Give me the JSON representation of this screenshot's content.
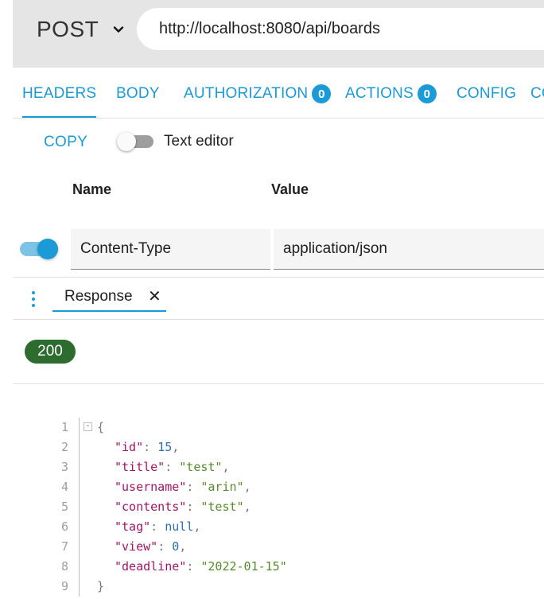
{
  "request": {
    "method": "POST",
    "url": "http://localhost:8080/api/boards"
  },
  "tabs": [
    {
      "label": "HEADERS",
      "active": true
    },
    {
      "label": "BODY"
    },
    {
      "label": "AUTHORIZATION",
      "badge": "0"
    },
    {
      "label": "ACTIONS",
      "badge": "0"
    },
    {
      "label": "CONFIG"
    },
    {
      "label": "CO"
    }
  ],
  "headers_panel": {
    "copy_label": "COPY",
    "text_editor_label": "Text editor",
    "text_editor_enabled": false,
    "name_column": "Name",
    "value_column": "Value",
    "rows": [
      {
        "enabled": true,
        "name": "Content-Type",
        "value": "application/json"
      }
    ]
  },
  "response": {
    "tab_label": "Response",
    "close_symbol": "✕",
    "status_code": "200",
    "status_color": "#2e6b2e"
  },
  "code": {
    "line_numbers": [
      "1",
      "2",
      "3",
      "4",
      "5",
      "6",
      "7",
      "8",
      "9"
    ],
    "fold_symbol": "-",
    "open_brace": "{",
    "close_brace": "}",
    "entries": [
      {
        "key": "\"id\"",
        "value": "15",
        "type": "number",
        "comma": ","
      },
      {
        "key": "\"title\"",
        "value": "\"test\"",
        "type": "string",
        "comma": ","
      },
      {
        "key": "\"username\"",
        "value": "\"arin\"",
        "type": "string",
        "comma": ","
      },
      {
        "key": "\"contents\"",
        "value": "\"test\"",
        "type": "string",
        "comma": ","
      },
      {
        "key": "\"tag\"",
        "value": "null",
        "type": "number",
        "comma": ","
      },
      {
        "key": "\"view\"",
        "value": "0",
        "type": "number",
        "comma": ","
      },
      {
        "key": "\"deadline\"",
        "value": "\"2022-01-15\"",
        "type": "string",
        "comma": ""
      }
    ]
  },
  "colors": {
    "accent": "#1a9ad6",
    "json_key": "#a31568",
    "json_string": "#578a2c",
    "json_number": "#2b6fb0"
  },
  "icons": {
    "method_dropdown": "chevron-down-icon",
    "more_options": "kebab-menu-icon",
    "close_tab": "close-icon"
  }
}
